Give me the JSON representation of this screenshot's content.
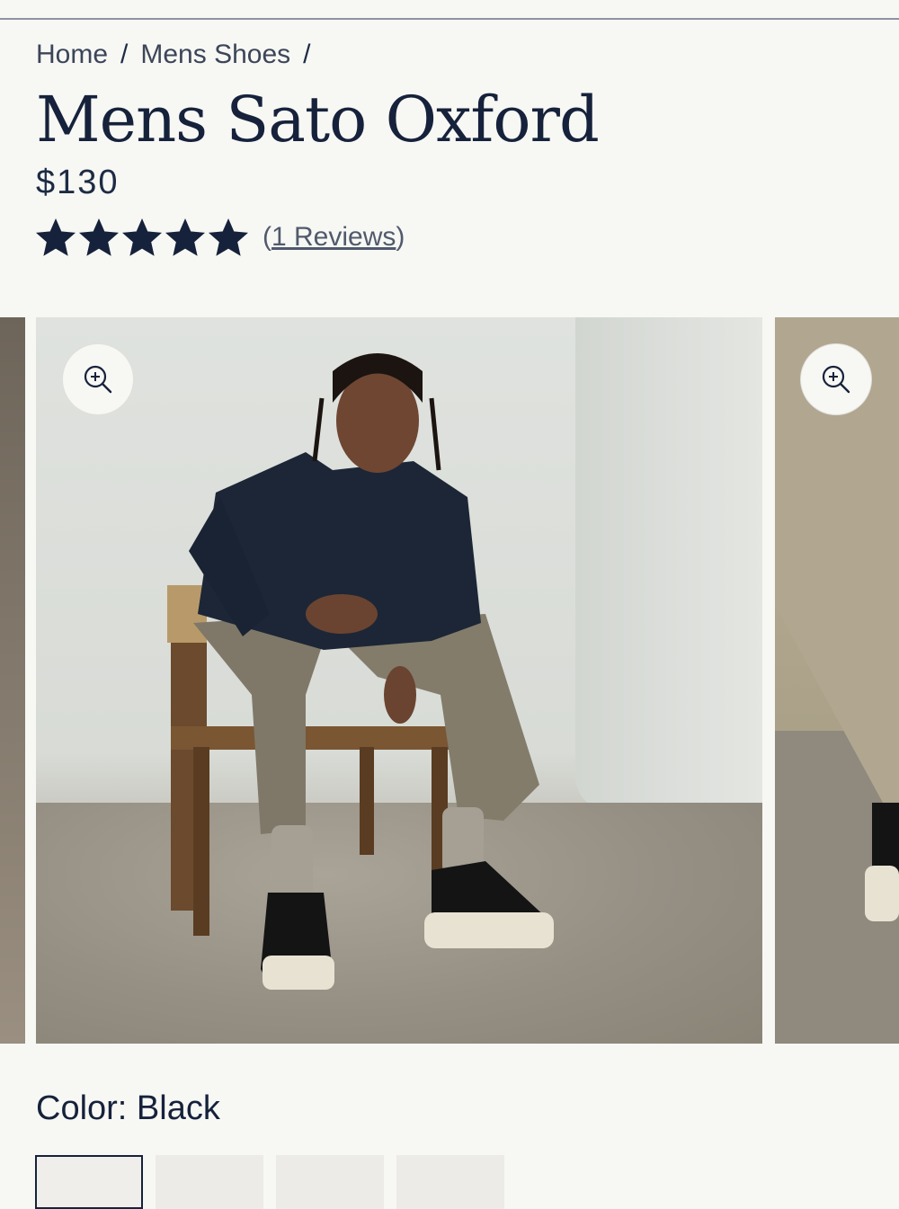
{
  "breadcrumb": {
    "items": [
      "Home",
      "Mens Shoes"
    ],
    "separator": "/"
  },
  "product": {
    "title": "Mens Sato Oxford",
    "price": "$130",
    "rating": 5,
    "rating_max": 5,
    "reviews_open": "(",
    "reviews_label": "1 Reviews",
    "reviews_close": ")"
  },
  "gallery": {
    "images": [
      {
        "name": "previous-image-partial",
        "alt": ""
      },
      {
        "name": "model-seated-image",
        "alt": ""
      },
      {
        "name": "next-image-partial",
        "alt": ""
      }
    ],
    "zoom_icon": "zoom-in-icon"
  },
  "color": {
    "label": "Color: Black",
    "swatch_count": 4,
    "selected_index": 0
  },
  "colors": {
    "text": "#1d2b44",
    "title": "#16223b",
    "background": "#f7f7f4"
  }
}
